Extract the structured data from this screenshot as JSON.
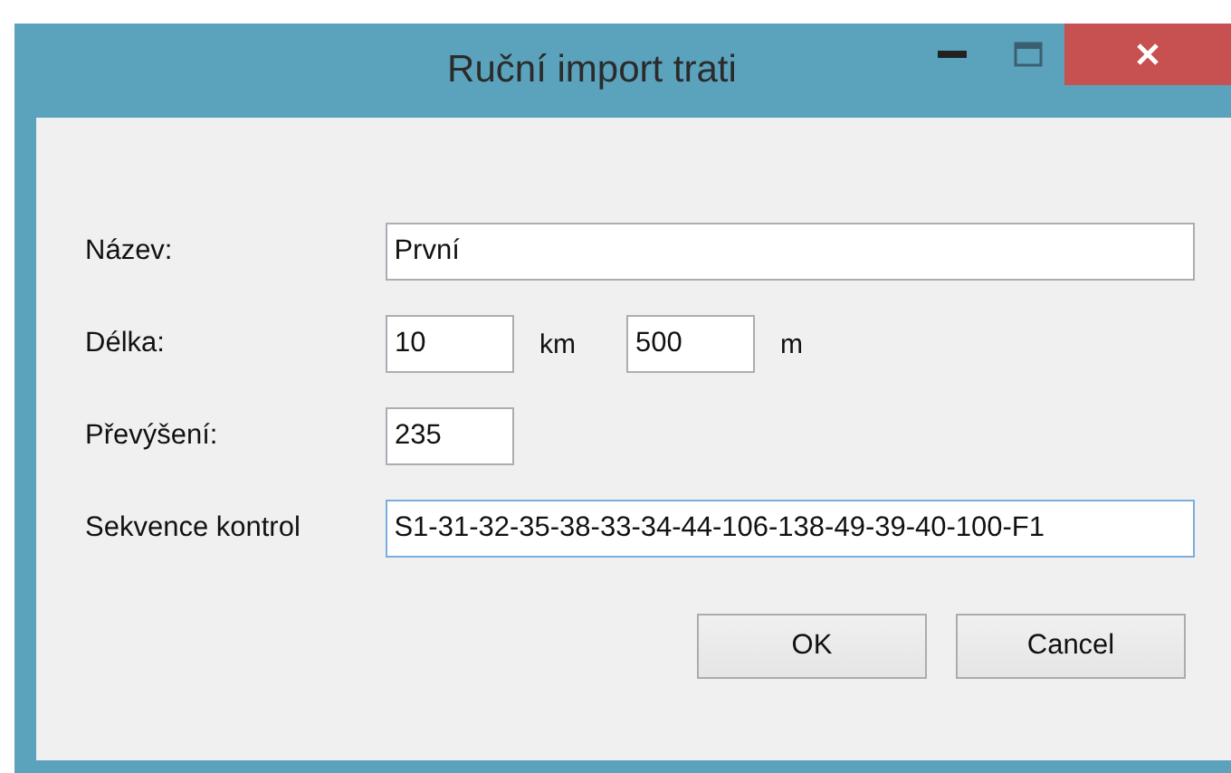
{
  "window": {
    "title": "Ruční import trati"
  },
  "rows": [
    {
      "label": "Název:",
      "inputs": [
        {
          "kind": "wide",
          "value": "První",
          "focused": false
        }
      ]
    },
    {
      "label": "Délka:",
      "inputs": [
        {
          "kind": "short",
          "value": "10",
          "unit": "km",
          "focused": false
        },
        {
          "kind": "short",
          "value": "500",
          "unit": "m",
          "focused": false
        }
      ]
    },
    {
      "label": "Převýšení:",
      "inputs": [
        {
          "kind": "short",
          "value": "235",
          "focused": false
        }
      ]
    },
    {
      "label": "Sekvence kontrol",
      "inputs": [
        {
          "kind": "wide",
          "value": "S1-31-32-35-38-33-34-44-106-138-49-39-40-100-F1",
          "focused": true
        }
      ]
    }
  ],
  "buttons": [
    {
      "label": "OK"
    },
    {
      "label": "Cancel"
    }
  ]
}
